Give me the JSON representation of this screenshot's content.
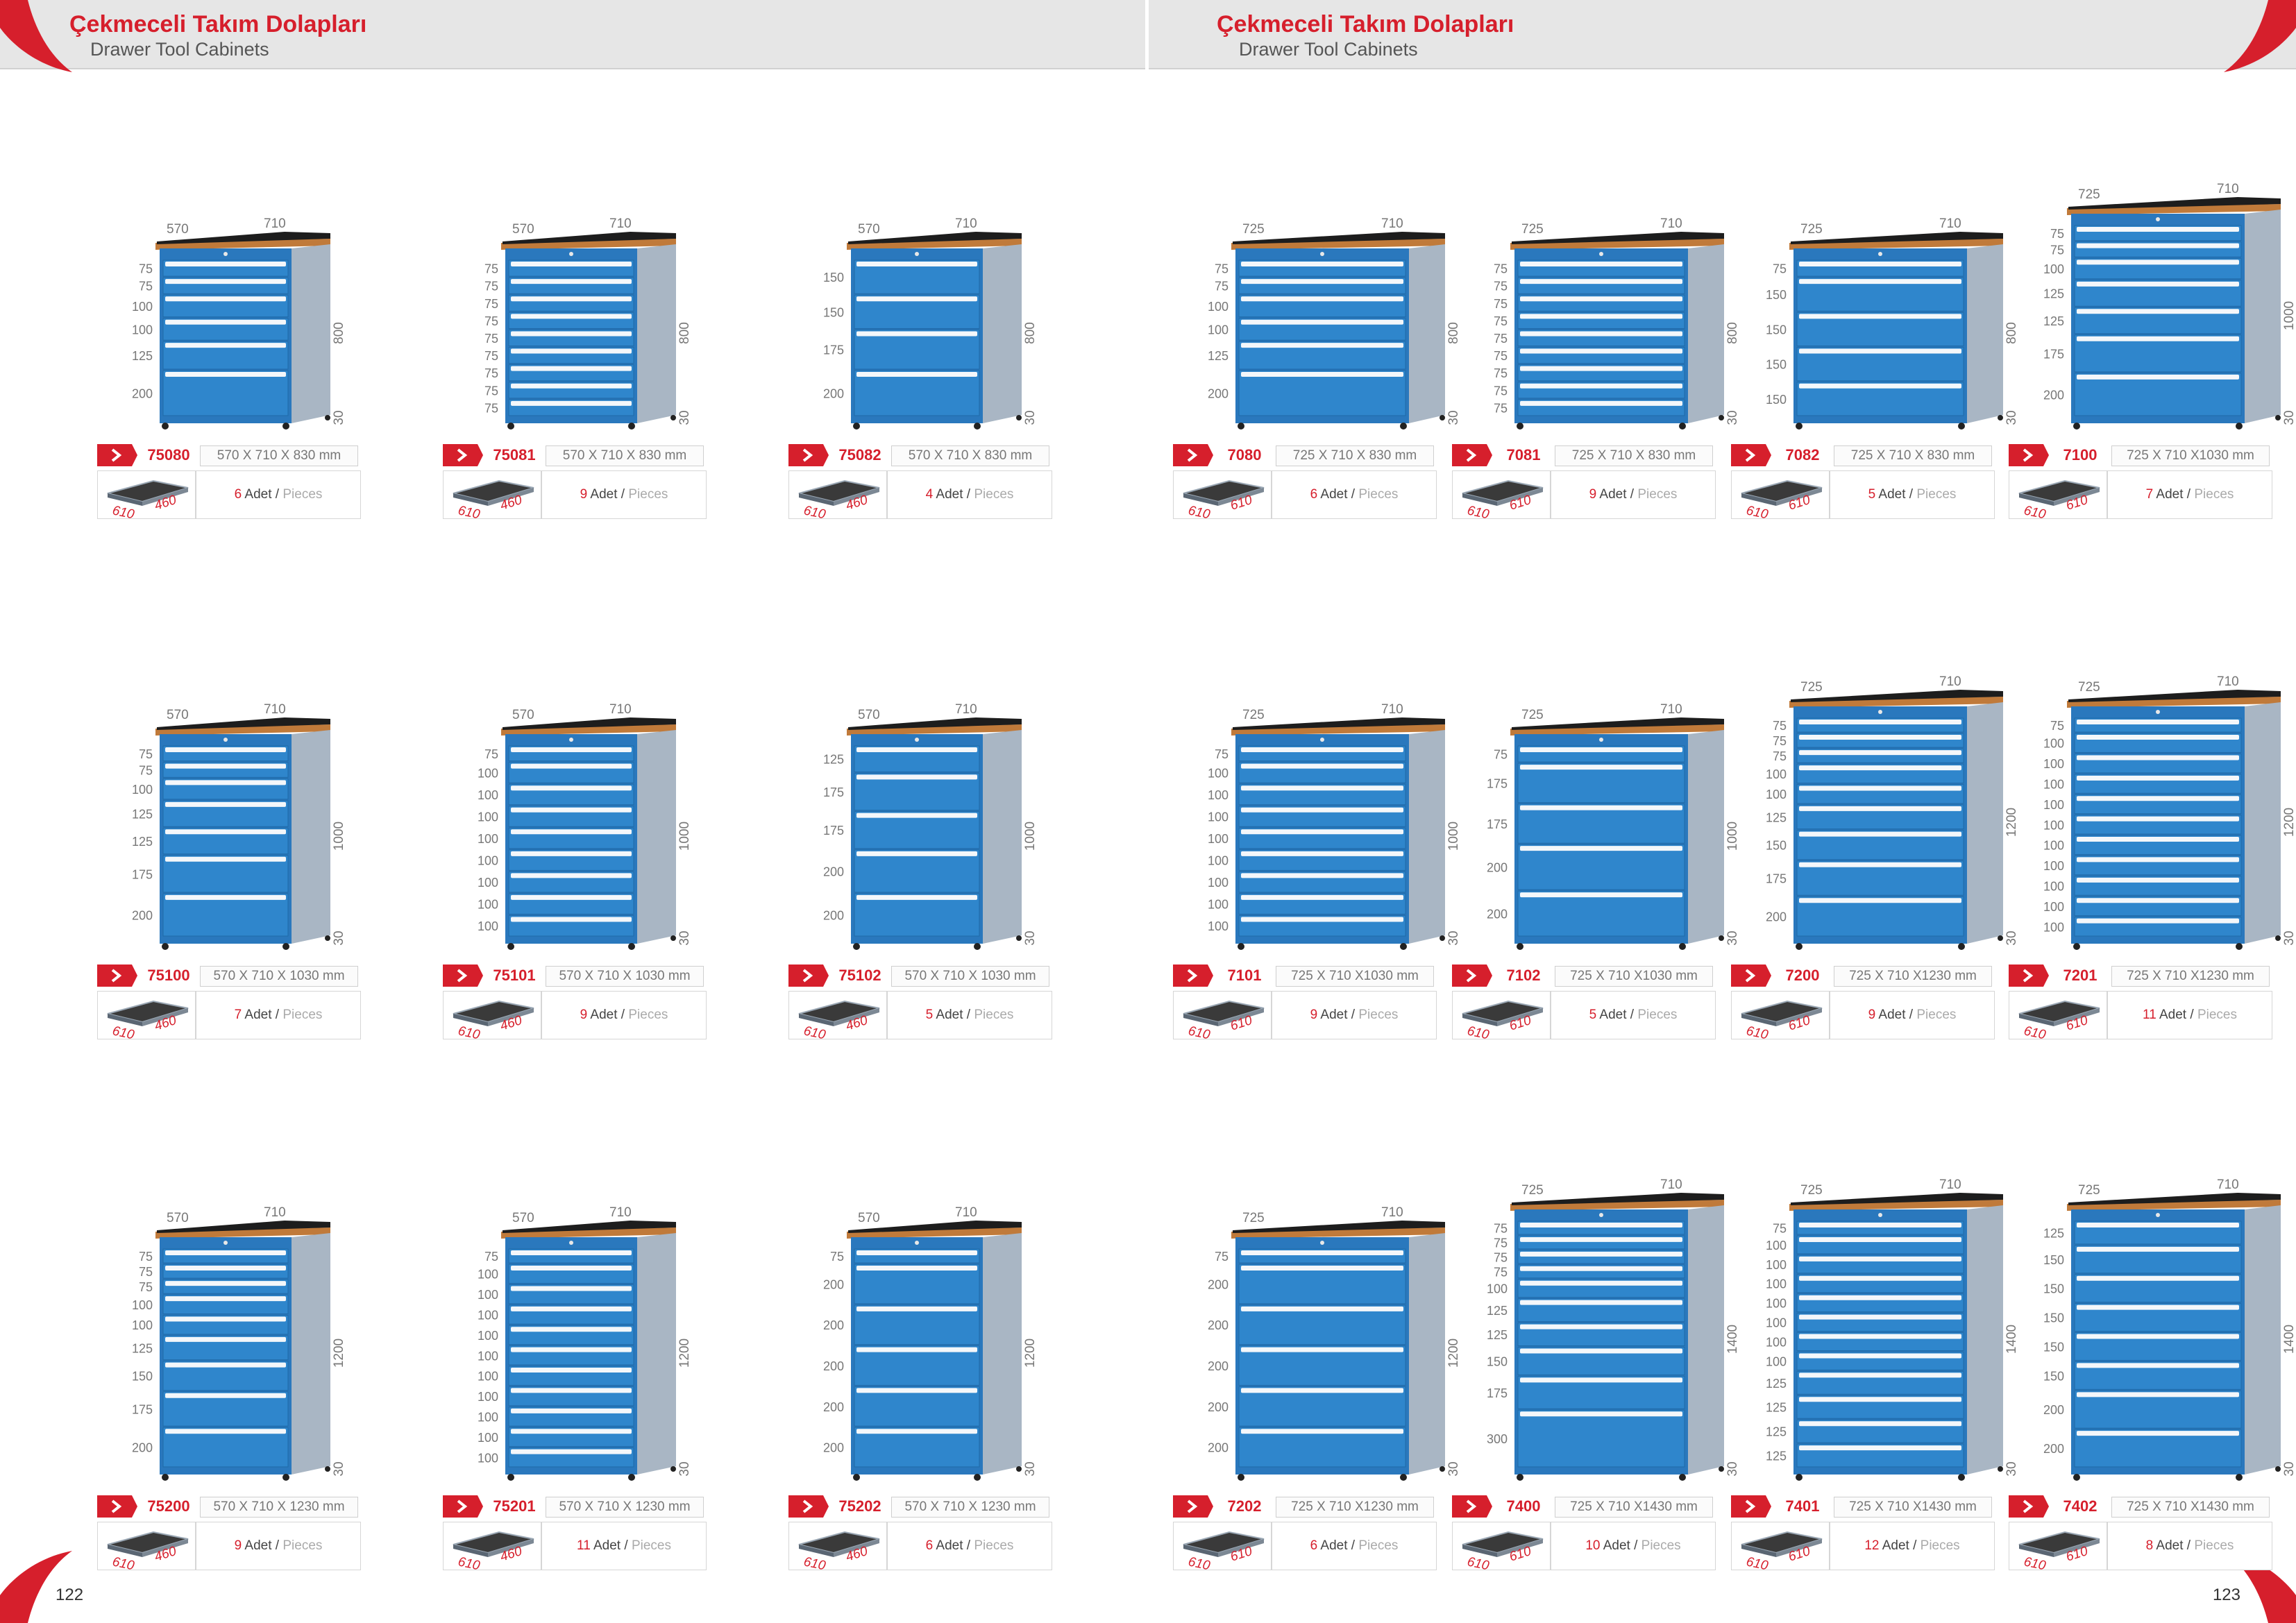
{
  "header": {
    "title_tr": "Çekmeceli Takım Dolapları",
    "title_en": "Drawer Tool Cabinets"
  },
  "pages": {
    "left": "122",
    "right": "123"
  },
  "labels": {
    "adet": "Adet",
    "pieces": "Pieces",
    "separator": " / "
  },
  "colors": {
    "accent": "#d61f2c",
    "drawer_blue": "#2f86cc",
    "cabinet_grey": "#a9b6c4",
    "worktop": "#1d1d1d",
    "worktop_edge": "#c07a3a"
  },
  "products": [
    {
      "code": "75080",
      "dims": "570 X 710 X 830 mm",
      "width": "570",
      "depth": "710",
      "height": "800",
      "base": "30",
      "drawers": [
        "75",
        "75",
        "100",
        "100",
        "125",
        "200"
      ],
      "count": "6",
      "tray_w": "610",
      "tray_d": "460"
    },
    {
      "code": "75081",
      "dims": "570 X 710 X 830 mm",
      "width": "570",
      "depth": "710",
      "height": "800",
      "base": "30",
      "drawers": [
        "75",
        "75",
        "75",
        "75",
        "75",
        "75",
        "75",
        "75",
        "75"
      ],
      "count": "9",
      "tray_w": "610",
      "tray_d": "460"
    },
    {
      "code": "75082",
      "dims": "570 X 710 X 830 mm",
      "width": "570",
      "depth": "710",
      "height": "800",
      "base": "30",
      "drawers": [
        "150",
        "150",
        "175",
        "200"
      ],
      "count": "4",
      "tray_w": "610",
      "tray_d": "460"
    },
    {
      "code": "7080",
      "dims": "725 X 710 X 830 mm",
      "width": "725",
      "depth": "710",
      "height": "800",
      "base": "30",
      "drawers": [
        "75",
        "75",
        "100",
        "100",
        "125",
        "200"
      ],
      "count": "6",
      "tray_w": "610",
      "tray_d": "610"
    },
    {
      "code": "7081",
      "dims": "725 X 710 X 830 mm",
      "width": "725",
      "depth": "710",
      "height": "800",
      "base": "30",
      "drawers": [
        "75",
        "75",
        "75",
        "75",
        "75",
        "75",
        "75",
        "75",
        "75"
      ],
      "count": "9",
      "tray_w": "610",
      "tray_d": "610"
    },
    {
      "code": "7082",
      "dims": "725 X 710 X 830 mm",
      "width": "725",
      "depth": "710",
      "height": "800",
      "base": "30",
      "drawers": [
        "75",
        "150",
        "150",
        "150",
        "150"
      ],
      "count": "5",
      "tray_w": "610",
      "tray_d": "610"
    },
    {
      "code": "7100",
      "dims": "725 X 710 X1030 mm",
      "width": "725",
      "depth": "710",
      "height": "1000",
      "base": "30",
      "drawers": [
        "75",
        "75",
        "100",
        "125",
        "125",
        "175",
        "200"
      ],
      "count": "7",
      "tray_w": "610",
      "tray_d": "610"
    },
    {
      "code": "75100",
      "dims": "570 X 710 X 1030 mm",
      "width": "570",
      "depth": "710",
      "height": "1000",
      "base": "30",
      "drawers": [
        "75",
        "75",
        "100",
        "125",
        "125",
        "175",
        "200"
      ],
      "count": "7",
      "tray_w": "610",
      "tray_d": "460"
    },
    {
      "code": "75101",
      "dims": "570 X 710 X 1030 mm",
      "width": "570",
      "depth": "710",
      "height": "1000",
      "base": "30",
      "drawers": [
        "75",
        "100",
        "100",
        "100",
        "100",
        "100",
        "100",
        "100",
        "100"
      ],
      "count": "9",
      "tray_w": "610",
      "tray_d": "460"
    },
    {
      "code": "75102",
      "dims": "570 X 710 X 1030 mm",
      "width": "570",
      "depth": "710",
      "height": "1000",
      "base": "30",
      "drawers": [
        "125",
        "175",
        "175",
        "200",
        "200"
      ],
      "count": "5",
      "tray_w": "610",
      "tray_d": "460"
    },
    {
      "code": "7101",
      "dims": "725 X 710 X1030 mm",
      "width": "725",
      "depth": "710",
      "height": "1000",
      "base": "30",
      "drawers": [
        "75",
        "100",
        "100",
        "100",
        "100",
        "100",
        "100",
        "100",
        "100"
      ],
      "count": "9",
      "tray_w": "610",
      "tray_d": "610"
    },
    {
      "code": "7102",
      "dims": "725 X 710 X1030 mm",
      "width": "725",
      "depth": "710",
      "height": "1000",
      "base": "30",
      "drawers": [
        "75",
        "175",
        "175",
        "200",
        "200"
      ],
      "count": "5",
      "tray_w": "610",
      "tray_d": "610"
    },
    {
      "code": "7200",
      "dims": "725 X 710 X1230 mm",
      "width": "725",
      "depth": "710",
      "height": "1200",
      "base": "30",
      "drawers": [
        "75",
        "75",
        "75",
        "100",
        "100",
        "125",
        "150",
        "175",
        "200"
      ],
      "count": "9",
      "tray_w": "610",
      "tray_d": "610"
    },
    {
      "code": "7201",
      "dims": "725 X 710 X1230 mm",
      "width": "725",
      "depth": "710",
      "height": "1200",
      "base": "30",
      "drawers": [
        "75",
        "100",
        "100",
        "100",
        "100",
        "100",
        "100",
        "100",
        "100",
        "100",
        "100"
      ],
      "count": "11",
      "tray_w": "610",
      "tray_d": "610"
    },
    {
      "code": "75200",
      "dims": "570 X 710 X 1230 mm",
      "width": "570",
      "depth": "710",
      "height": "1200",
      "base": "30",
      "drawers": [
        "75",
        "75",
        "75",
        "100",
        "100",
        "125",
        "150",
        "175",
        "200"
      ],
      "count": "9",
      "tray_w": "610",
      "tray_d": "460"
    },
    {
      "code": "75201",
      "dims": "570 X 710 X 1230 mm",
      "width": "570",
      "depth": "710",
      "height": "1200",
      "base": "30",
      "drawers": [
        "75",
        "100",
        "100",
        "100",
        "100",
        "100",
        "100",
        "100",
        "100",
        "100",
        "100"
      ],
      "count": "11",
      "tray_w": "610",
      "tray_d": "460"
    },
    {
      "code": "75202",
      "dims": "570 X 710 X 1230 mm",
      "width": "570",
      "depth": "710",
      "height": "1200",
      "base": "30",
      "drawers": [
        "75",
        "200",
        "200",
        "200",
        "200",
        "200"
      ],
      "count": "6",
      "tray_w": "610",
      "tray_d": "460"
    },
    {
      "code": "7202",
      "dims": "725 X 710 X1230 mm",
      "width": "725",
      "depth": "710",
      "height": "1200",
      "base": "30",
      "drawers": [
        "75",
        "200",
        "200",
        "200",
        "200",
        "200"
      ],
      "count": "6",
      "tray_w": "610",
      "tray_d": "610"
    },
    {
      "code": "7400",
      "dims": "725 X 710 X1430 mm",
      "width": "725",
      "depth": "710",
      "height": "1400",
      "base": "30",
      "drawers": [
        "75",
        "75",
        "75",
        "75",
        "100",
        "125",
        "125",
        "150",
        "175",
        "300"
      ],
      "count": "10",
      "tray_w": "610",
      "tray_d": "610"
    },
    {
      "code": "7401",
      "dims": "725 X 710 X1430 mm",
      "width": "725",
      "depth": "710",
      "height": "1400",
      "base": "30",
      "drawers": [
        "75",
        "100",
        "100",
        "100",
        "100",
        "100",
        "100",
        "100",
        "125",
        "125",
        "125",
        "125"
      ],
      "count": "12",
      "tray_w": "610",
      "tray_d": "610"
    },
    {
      "code": "7402",
      "dims": "725 X 710 X1430 mm",
      "width": "725",
      "depth": "710",
      "height": "1400",
      "base": "30",
      "drawers": [
        "125",
        "150",
        "150",
        "150",
        "150",
        "150",
        "200",
        "200"
      ],
      "count": "8",
      "tray_w": "610",
      "tray_d": "610"
    }
  ]
}
